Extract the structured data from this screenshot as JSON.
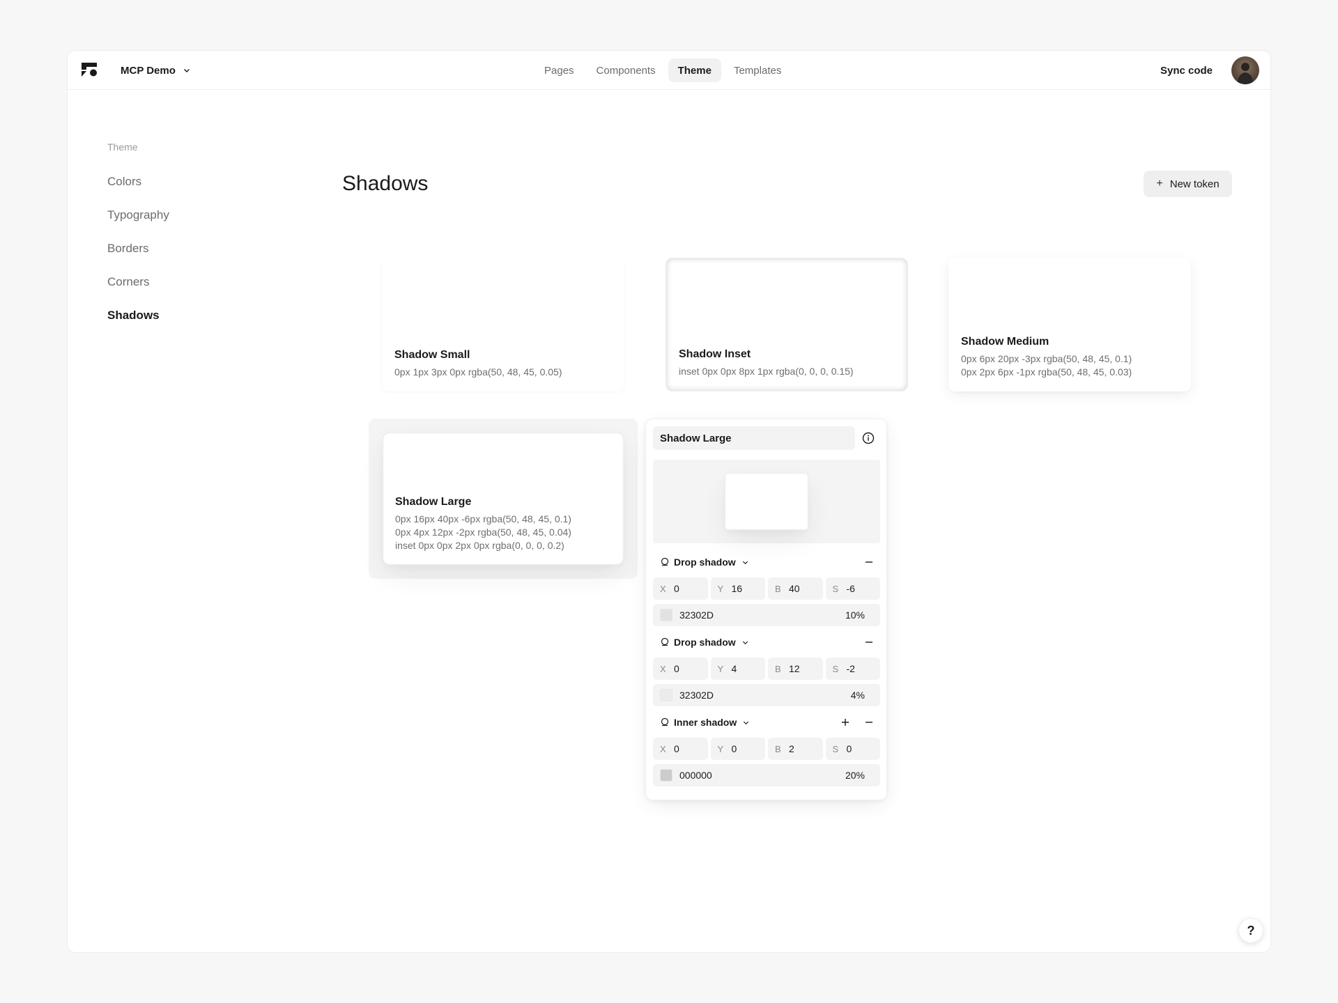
{
  "header": {
    "project_name": "MCP Demo",
    "tabs": [
      {
        "label": "Pages",
        "active": false
      },
      {
        "label": "Components",
        "active": false
      },
      {
        "label": "Theme",
        "active": true
      },
      {
        "label": "Templates",
        "active": false
      }
    ],
    "sync_label": "Sync code"
  },
  "sidebar": {
    "section_title": "Theme",
    "items": [
      {
        "label": "Colors",
        "active": false
      },
      {
        "label": "Typography",
        "active": false
      },
      {
        "label": "Borders",
        "active": false
      },
      {
        "label": "Corners",
        "active": false
      },
      {
        "label": "Shadows",
        "active": true
      }
    ]
  },
  "main": {
    "title": "Shadows",
    "new_token_label": "New token",
    "cards": [
      {
        "name": "Shadow Small",
        "lines": [
          "0px 1px 3px 0px rgba(50, 48, 45, 0.05)"
        ]
      },
      {
        "name": "Shadow Inset",
        "lines": [
          "inset 0px 0px 8px 1px rgba(0, 0, 0, 0.15)"
        ]
      },
      {
        "name": "Shadow Medium",
        "lines": [
          "0px 6px 20px -3px rgba(50, 48, 45, 0.1)",
          "0px 2px 6px -1px rgba(50, 48, 45, 0.03)"
        ]
      },
      {
        "name": "Shadow Large",
        "lines": [
          "0px 16px 40px -6px rgba(50, 48, 45, 0.1)",
          "0px 4px 12px -2px rgba(50, 48, 45, 0.04)",
          "inset 0px 0px 2px 0px rgba(0, 0, 0, 0.2)"
        ]
      }
    ]
  },
  "editor": {
    "token_name": "Shadow Large",
    "layers": [
      {
        "type": "Drop shadow",
        "x": "0",
        "y": "16",
        "b": "40",
        "s": "-6",
        "hex": "32302D",
        "alpha": "10%",
        "swatch": "#e2e2e2",
        "can_add": false
      },
      {
        "type": "Drop shadow",
        "x": "0",
        "y": "4",
        "b": "12",
        "s": "-2",
        "hex": "32302D",
        "alpha": "4%",
        "swatch": "#ececec",
        "can_add": false
      },
      {
        "type": "Inner shadow",
        "x": "0",
        "y": "0",
        "b": "2",
        "s": "0",
        "hex": "000000",
        "alpha": "20%",
        "swatch": "#cccccc",
        "can_add": true
      }
    ],
    "field_labels": {
      "x": "X",
      "y": "Y",
      "b": "B",
      "s": "S"
    }
  },
  "help_label": "?",
  "colors": {
    "accent_bg": "#f1f1f1",
    "text": "#1a1a1a",
    "muted": "#6b6b6b"
  }
}
